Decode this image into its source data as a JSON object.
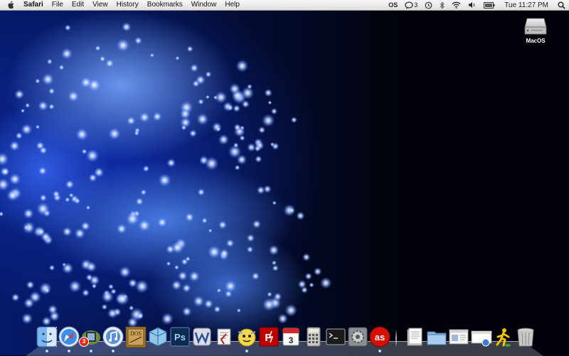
{
  "menubar": {
    "app_name": "Safari",
    "menus": [
      "File",
      "Edit",
      "View",
      "History",
      "Bookmarks",
      "Window",
      "Help"
    ],
    "status": {
      "lastfm_label": "OS",
      "notification_count": "3",
      "clock": "Tue 11:27 PM"
    }
  },
  "desktop": {
    "drive_label": "MacOS"
  },
  "dock": {
    "calendar_date": "3",
    "mail_badge": "3",
    "photoshop_label": "Ps",
    "dosbox_label": "DOS"
  },
  "colors": {
    "wallpaper_accent": "#2f6bff",
    "menubar": "#ececec",
    "lastfm_red": "#d51007",
    "filezilla_red": "#bf0000"
  }
}
